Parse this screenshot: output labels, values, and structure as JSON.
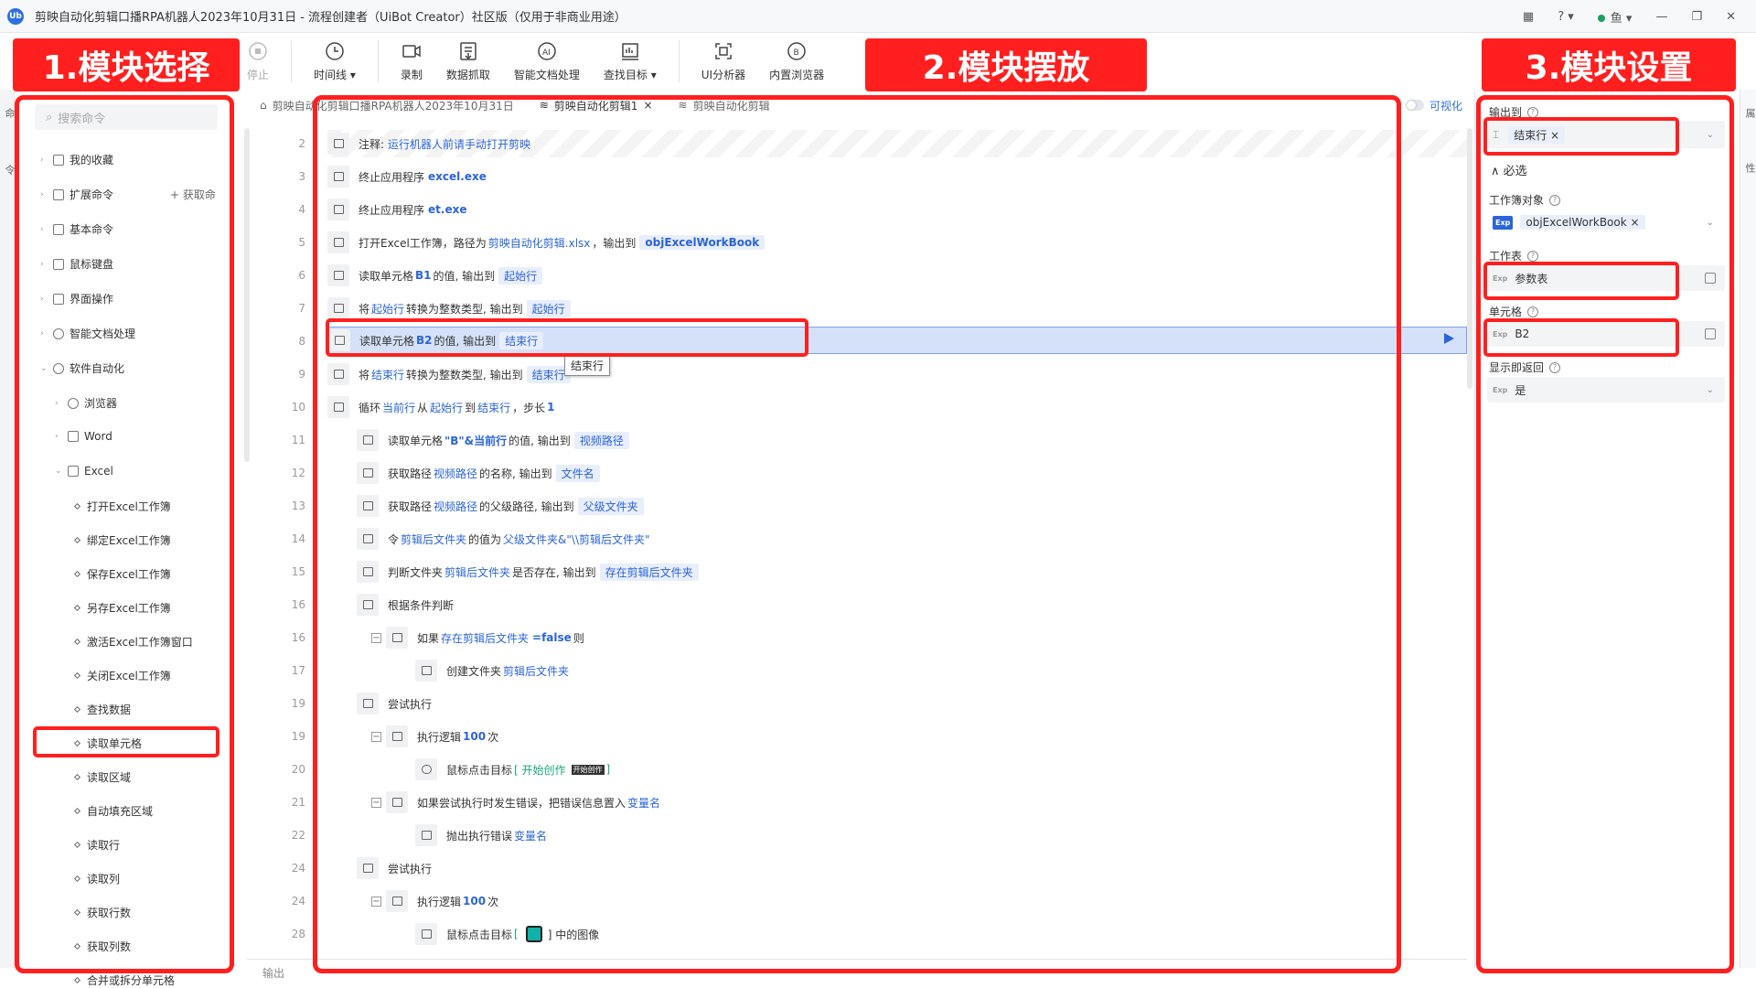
{
  "titlebar": {
    "logo": "Ub",
    "title": "剪映自动化剪辑口播RPA机器人2023年10月31日 - 流程创建者（UiBot Creator）社区版（仅用于非商业用途）",
    "user": "鱼",
    "icons": [
      "apps-icon",
      "help-icon",
      "user-status-icon",
      "minimize-icon",
      "restore-icon",
      "close-icon"
    ]
  },
  "toolbar": {
    "buttons": [
      {
        "label": "停止"
      },
      {
        "label": "时间线 ▾"
      },
      {
        "label": "录制"
      },
      {
        "label": "数据抓取"
      },
      {
        "label": "智能文档处理"
      },
      {
        "label": "查找目标 ▾"
      },
      {
        "label": "UI分析器"
      },
      {
        "label": "内置浏览器"
      }
    ]
  },
  "callouts": {
    "one": "1.模块选择",
    "two": "2.模块摆放",
    "three": "3.模块设置"
  },
  "left_strip": {
    "tab1": "命",
    "tab2": "令"
  },
  "left_panel": {
    "search_placeholder": "搜索命令",
    "get_cmd": "+ 获取命",
    "tree": [
      {
        "label": "我的收藏"
      },
      {
        "label": "扩展命令"
      },
      {
        "label": "基本命令"
      },
      {
        "label": "鼠标键盘"
      },
      {
        "label": "界面操作"
      },
      {
        "label": "智能文档处理"
      },
      {
        "label": "软件自动化"
      },
      {
        "label": "浏览器"
      },
      {
        "label": "Word"
      },
      {
        "label": "Excel"
      }
    ],
    "leaves": [
      "打开Excel工作簿",
      "绑定Excel工作簿",
      "保存Excel工作簿",
      "另存Excel工作簿",
      "激活Excel工作簿窗口",
      "关闭Excel工作簿",
      "查找数据",
      "读取单元格",
      "读取区域",
      "自动填充区域",
      "读取行",
      "读取列",
      "获取行数",
      "获取列数",
      "合并或拆分单元格"
    ]
  },
  "tabs": [
    "剪映自动化剪辑口播RPA机器人2023年10月31日",
    "剪映自动化剪辑1",
    "剪映自动化剪辑"
  ],
  "visualize": "可视化",
  "code": {
    "line_numbers": [
      "2",
      "3",
      "4",
      "5",
      "6",
      "7",
      "8",
      "9",
      "10",
      "11",
      "12",
      "13",
      "14",
      "15",
      "16",
      "16",
      "17",
      "19",
      "19",
      "20",
      "21",
      "22",
      "24",
      "24",
      "28"
    ],
    "r2": {
      "a": "注释:",
      "b": "运行机器人前请手动打开剪映"
    },
    "r3": {
      "a": "终止应用程序",
      "b": "excel.exe"
    },
    "r4": {
      "a": "终止应用程序",
      "b": "et.exe"
    },
    "r5": {
      "a": "打开Excel工作簿，路径为",
      "b": "剪映自动化剪辑.xlsx",
      "c": "，输出到",
      "d": "objExcelWorkBook"
    },
    "r6": {
      "a": "读取单元格",
      "b": "B1",
      "c": "的值, 输出到",
      "d": "起始行"
    },
    "r7": {
      "a": "将",
      "b": "起始行",
      "c": "转换为整数类型, 输出到",
      "d": "起始行"
    },
    "r8": {
      "a": "读取单元格",
      "b": "B2",
      "c": "的值, 输出到",
      "d": "结束行"
    },
    "r9": {
      "a": "将",
      "b": "结束行",
      "c": "转换为整数类型, 输出到",
      "d": "结束行"
    },
    "r10": {
      "a": "循环",
      "b": "当前行",
      "c": "从",
      "d": "起始行",
      "e": "到",
      "f": "结束行",
      "g": "，步长",
      "h": "1"
    },
    "r11": {
      "a": "读取单元格",
      "b": "\"B\"&当前行",
      "c": "的值, 输出到",
      "d": "视频路径"
    },
    "r12": {
      "a": "获取路径",
      "b": "视频路径",
      "c": "的名称, 输出到",
      "d": "文件名"
    },
    "r13": {
      "a": "获取路径",
      "b": "视频路径",
      "c": "的父级路径, 输出到",
      "d": "父级文件夹"
    },
    "r14": {
      "a": "令",
      "b": "剪辑后文件夹",
      "c": "的值为",
      "d": "父级文件夹&\"\\\\剪辑后文件夹\""
    },
    "r15": {
      "a": "判断文件夹",
      "b": "剪辑后文件夹",
      "c": "是否存在, 输出到",
      "d": "存在剪辑后文件夹"
    },
    "r16": {
      "a": "根据条件判断"
    },
    "r16b": {
      "a": "如果",
      "b": "存在剪辑后文件夹",
      "c": "=false",
      "d": "则"
    },
    "r17": {
      "a": "创建文件夹",
      "b": "剪辑后文件夹"
    },
    "r19": {
      "a": "尝试执行"
    },
    "r19b": {
      "a": "执行逻辑",
      "b": "100",
      "c": "次"
    },
    "r20": {
      "a": "鼠标点击目标",
      "b": "[ 开始创作",
      "c": "开始创作",
      "d": "]"
    },
    "r21": {
      "a": "如果尝试执行时发生错误，把错误信息置入",
      "b": "变量名"
    },
    "r22": {
      "a": "抛出执行错误",
      "b": "变量名"
    },
    "r24": {
      "a": "尝试执行"
    },
    "r24b": {
      "a": "执行逻辑",
      "b": "100",
      "c": "次"
    },
    "r28": {
      "a": "鼠标点击目标",
      "b": "[",
      "c": "] 中的图像"
    }
  },
  "tooltip": "结束行",
  "output_label": "输出",
  "right_panel": {
    "output_to": "输出到",
    "output_value": "结束行",
    "required": "∧ 必选",
    "workbook_label": "工作簿对象",
    "workbook_exp": "Exp",
    "workbook_value": "objExcelWorkBook",
    "sheet_label": "工作表",
    "sheet_exp": "Exp",
    "sheet_value": "参数表",
    "cell_label": "单元格",
    "cell_exp": "Exp",
    "cell_value": "B2",
    "show_return_label": "显示即返回",
    "show_return_exp": "Exp",
    "show_return_value": "是"
  },
  "right_strip": {
    "tab1": "属",
    "tab2": "性"
  },
  "colors": {
    "accent": "#2b64d8",
    "annotation": "#ff1f1f",
    "highlight": "#d5e1f8"
  }
}
